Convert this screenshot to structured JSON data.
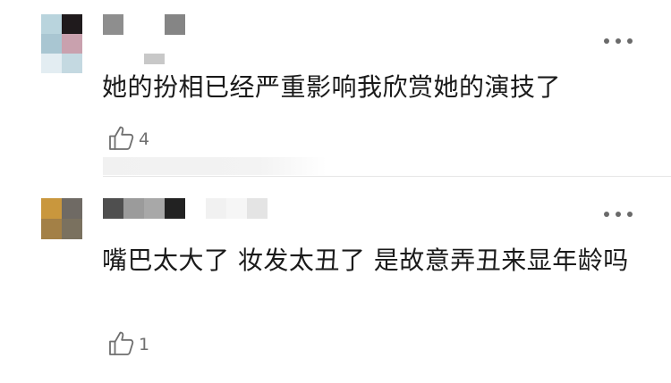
{
  "comments": [
    {
      "text": "她的扮相已经严重影响我欣赏她的演技了",
      "likes": "4"
    },
    {
      "text": "嘴巴太大了 妆发太丑了 是故意弄丑来显年龄吗",
      "likes": "1"
    }
  ],
  "icons": {
    "like": "thumbs-up-icon",
    "more": "more-options-icon"
  },
  "colors": {
    "text": "#1a1a1a",
    "meta": "#6f6f6f",
    "divider": "#e6e6e6"
  }
}
